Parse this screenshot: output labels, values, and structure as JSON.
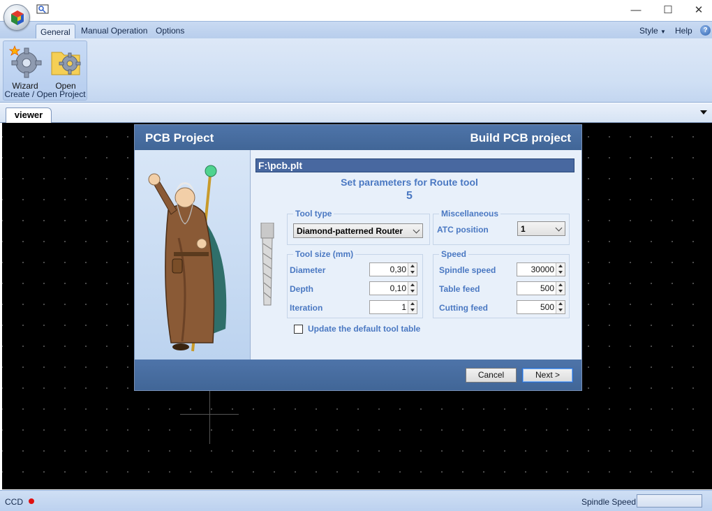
{
  "window": {
    "minimize_glyph": "—",
    "maximize_glyph": "☐",
    "close_glyph": "✕"
  },
  "ribbon": {
    "tabs": [
      "General",
      "Manual Operation",
      "Options"
    ],
    "active_tab": "General",
    "right_items": {
      "style": "Style",
      "help": "Help",
      "help_glyph": "?"
    },
    "group": {
      "label": "Create / Open Project",
      "buttons": [
        {
          "label": "Wizard",
          "icon": "wizard-gear-icon"
        },
        {
          "label": "Open",
          "icon": "open-folder-gear-icon"
        }
      ]
    }
  },
  "viewer": {
    "tab_label": "viewer"
  },
  "dialog": {
    "title_left": "PCB Project",
    "title_right": "Build PCB project",
    "file_path": "F:\\pcb.plt",
    "heading": "Set parameters for Route tool",
    "tool_number": "5",
    "tool_type": {
      "legend": "Tool type",
      "selected": "Diamond-patterned Router"
    },
    "misc": {
      "legend": "Miscellaneous",
      "atc_label": "ATC position",
      "atc_value": "1"
    },
    "tool_size": {
      "legend": "Tool size (mm)",
      "diameter_label": "Diameter",
      "diameter_value": "0,30",
      "depth_label": "Depth",
      "depth_value": "0,10",
      "iteration_label": "Iteration",
      "iteration_value": "1"
    },
    "speed": {
      "legend": "Speed",
      "spindle_label": "Spindle speed",
      "spindle_value": "30000",
      "table_label": "Table feed",
      "table_value": "500",
      "cutting_label": "Cutting feed",
      "cutting_value": "500"
    },
    "update_table_label": "Update the default tool table",
    "update_table_checked": false,
    "cancel_label": "Cancel",
    "next_label": "Next >"
  },
  "statusbar": {
    "ccd_label": "CCD",
    "ccd_status_color": "#e01010",
    "spindle_label": "Spindle Speed"
  },
  "colors": {
    "accent_blue": "#4a78c2",
    "dialog_header": "#4a6fa5",
    "canvas_bg": "#000000"
  }
}
